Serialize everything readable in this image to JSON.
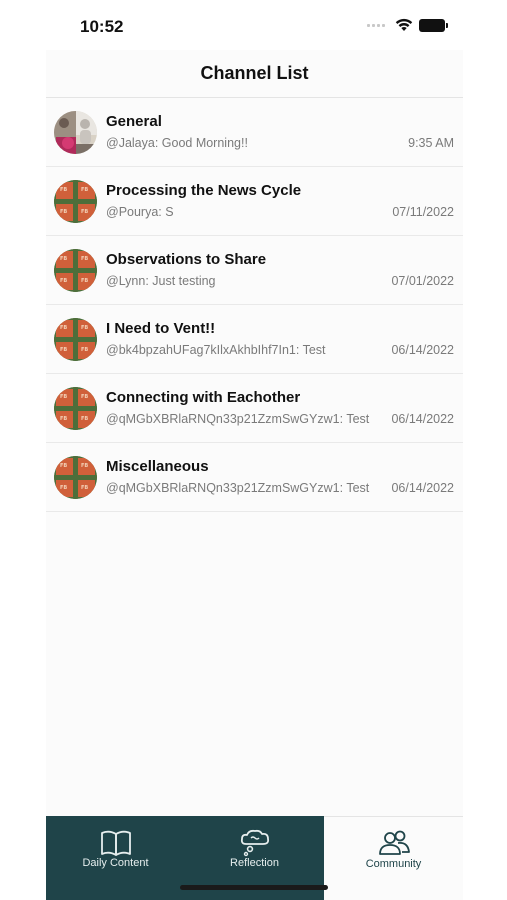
{
  "status_bar": {
    "time": "10:52"
  },
  "header": {
    "title": "Channel List"
  },
  "channels": [
    {
      "name": "General",
      "last_message": "@Jalaya: Good Morning!!",
      "date": "9:35 AM",
      "avatar": "photo-avatar"
    },
    {
      "name": "Processing the News Cycle",
      "last_message": "@Pourya: S",
      "date": "07/11/2022",
      "avatar": "fb-tile-avatar"
    },
    {
      "name": "Observations to Share",
      "last_message": "@Lynn: Just testing",
      "date": "07/01/2022",
      "avatar": "fb-tile-avatar"
    },
    {
      "name": "I Need to Vent!!",
      "last_message": "@bk4bpzahUFag7kIlxAkhbIhf7In1: Test",
      "date": "06/14/2022",
      "avatar": "fb-tile-avatar"
    },
    {
      "name": "Connecting with Eachother",
      "last_message": "@qMGbXBRlaRNQn33p21ZzmSwGYzw1: Test",
      "date": "06/14/2022",
      "avatar": "fb-tile-avatar"
    },
    {
      "name": "Miscellaneous",
      "last_message": "@qMGbXBRlaRNQn33p21ZzmSwGYzw1: Test",
      "date": "06/14/2022",
      "avatar": "fb-tile-avatar"
    }
  ],
  "tab_bar": {
    "tabs": [
      {
        "label": "Daily Content",
        "icon": "book-icon",
        "active": false
      },
      {
        "label": "Reflection",
        "icon": "thought-bubble-icon",
        "active": false
      },
      {
        "label": "Community",
        "icon": "people-icon",
        "active": true
      }
    ]
  },
  "colors": {
    "tab_dark": "#1f4449",
    "background": "#fbfbfb",
    "avatar_orange": "#d0603a",
    "avatar_green": "#4d6e3a"
  }
}
